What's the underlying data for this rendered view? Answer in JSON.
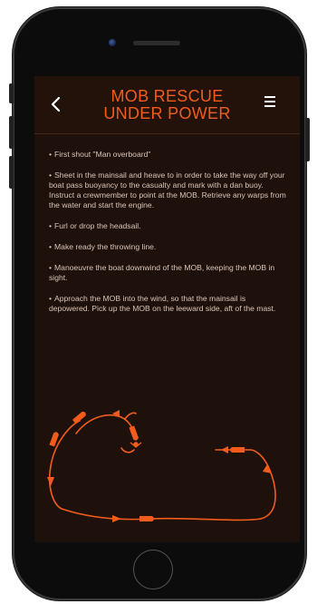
{
  "header": {
    "title_line1": "MOB RESCUE",
    "title_line2": "UNDER POWER",
    "back_icon": "chevron-left-icon",
    "menu_icon": "hamburger-menu-icon",
    "accent_color": "#f15c1c"
  },
  "instructions": [
    "First shout \"Man overboard\"",
    "Sheet in the mainsail and heave to in order to take the way off your boat pass buoyancy to the casualty and mark with a dan buoy. Instruct a crewmember to point at the MOB. Retrieve any warps from the water and start the engine.",
    "Furl or drop the headsail.",
    "Make ready the throwing line.",
    "Manoeuvre the boat downwind of the MOB, keeping the MOB in sight.",
    "Approach the MOB into the wind, so that the mainsail is depowered. Pick up the MOB on the leeward side, aft of the mast."
  ],
  "bullet_char": "•",
  "diagram": {
    "icon": "mob-rescue-route-diagram",
    "boat_icon": "boat-icon",
    "swimmer_icon": "person-in-water-icon"
  },
  "colors": {
    "screen_bg": "#1e100a",
    "text": "#d9c5b8",
    "accent": "#f15c1c"
  }
}
